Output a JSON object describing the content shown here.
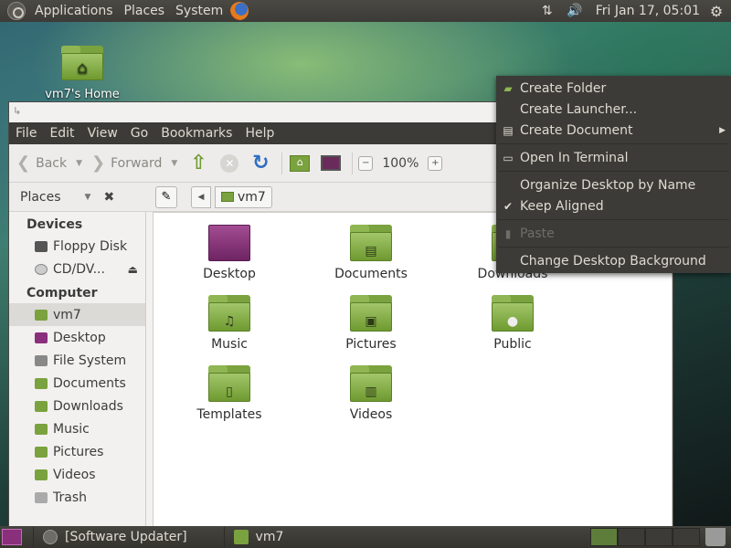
{
  "top_panel": {
    "menus": [
      "Applications",
      "Places",
      "System"
    ],
    "clock": "Fri Jan 17, 05:01"
  },
  "desktop": {
    "home_label": "vm7's Home"
  },
  "window": {
    "menubar": [
      "File",
      "Edit",
      "View",
      "Go",
      "Bookmarks",
      "Help"
    ],
    "toolbar": {
      "back": "Back",
      "forward": "Forward",
      "zoom": "100%"
    },
    "places_label": "Places",
    "breadcrumb": "vm7",
    "sidebar": {
      "devices_header": "Devices",
      "devices": [
        "Floppy Disk",
        "CD/DV..."
      ],
      "computer_header": "Computer",
      "computer": [
        "vm7",
        "Desktop",
        "File System",
        "Documents",
        "Downloads",
        "Music",
        "Pictures",
        "Videos",
        "Trash"
      ]
    },
    "files": [
      "Desktop",
      "Documents",
      "Downloads",
      "Music",
      "Pictures",
      "Public",
      "Templates",
      "Videos"
    ]
  },
  "context_menu": {
    "items": [
      "Create Folder",
      "Create Launcher...",
      "Create Document",
      "Open In Terminal",
      "Organize Desktop by Name",
      "Keep Aligned",
      "Paste",
      "Change Desktop Background"
    ]
  },
  "bottom_panel": {
    "tasks": [
      "[Software Updater]",
      "vm7"
    ]
  },
  "colors": {
    "panel": "#3c3b37",
    "folder_green": "#7aa23e",
    "accent_purple": "#8a2f7c"
  }
}
